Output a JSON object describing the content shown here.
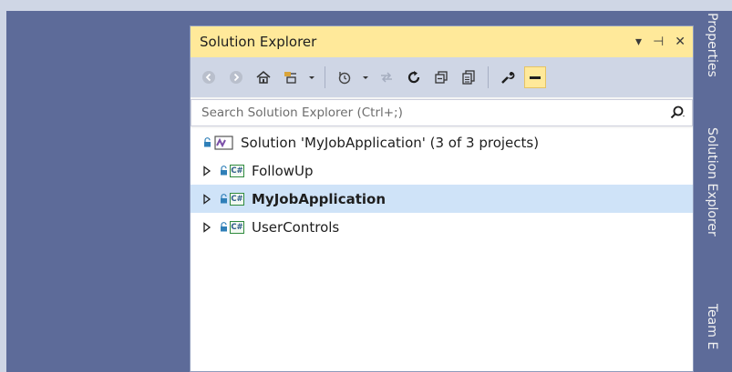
{
  "panel": {
    "title": "Solution Explorer",
    "title_controls": [
      "▾",
      "⊣",
      "✕"
    ],
    "search": {
      "placeholder": "Search Solution Explorer (Ctrl+;)"
    },
    "tree": {
      "solution_label": "Solution 'MyJobApplication' (3 of 3 projects)",
      "projects": [
        {
          "label": "FollowUp",
          "selected": false
        },
        {
          "label": "MyJobApplication",
          "selected": true
        },
        {
          "label": "UserControls",
          "selected": false
        }
      ]
    }
  },
  "side_tabs": [
    {
      "label": "Properties"
    },
    {
      "label": "Solution Explorer"
    },
    {
      "label": "Team E"
    }
  ],
  "colors": {
    "background": "#5d6b99",
    "titlebar": "#ffe99a",
    "toolbar": "#cfd6e5",
    "selection": "#cfe3f8"
  },
  "icons": {
    "toolbar": [
      "back-icon",
      "forward-icon",
      "home-icon",
      "switch-views-icon",
      "dropdown-arrow-icon",
      "pending-changes-icon",
      "dropdown-arrow-icon",
      "sync-icon",
      "refresh-icon",
      "collapse-all-icon",
      "show-all-files-icon",
      "properties-icon",
      "preview-icon"
    ]
  }
}
